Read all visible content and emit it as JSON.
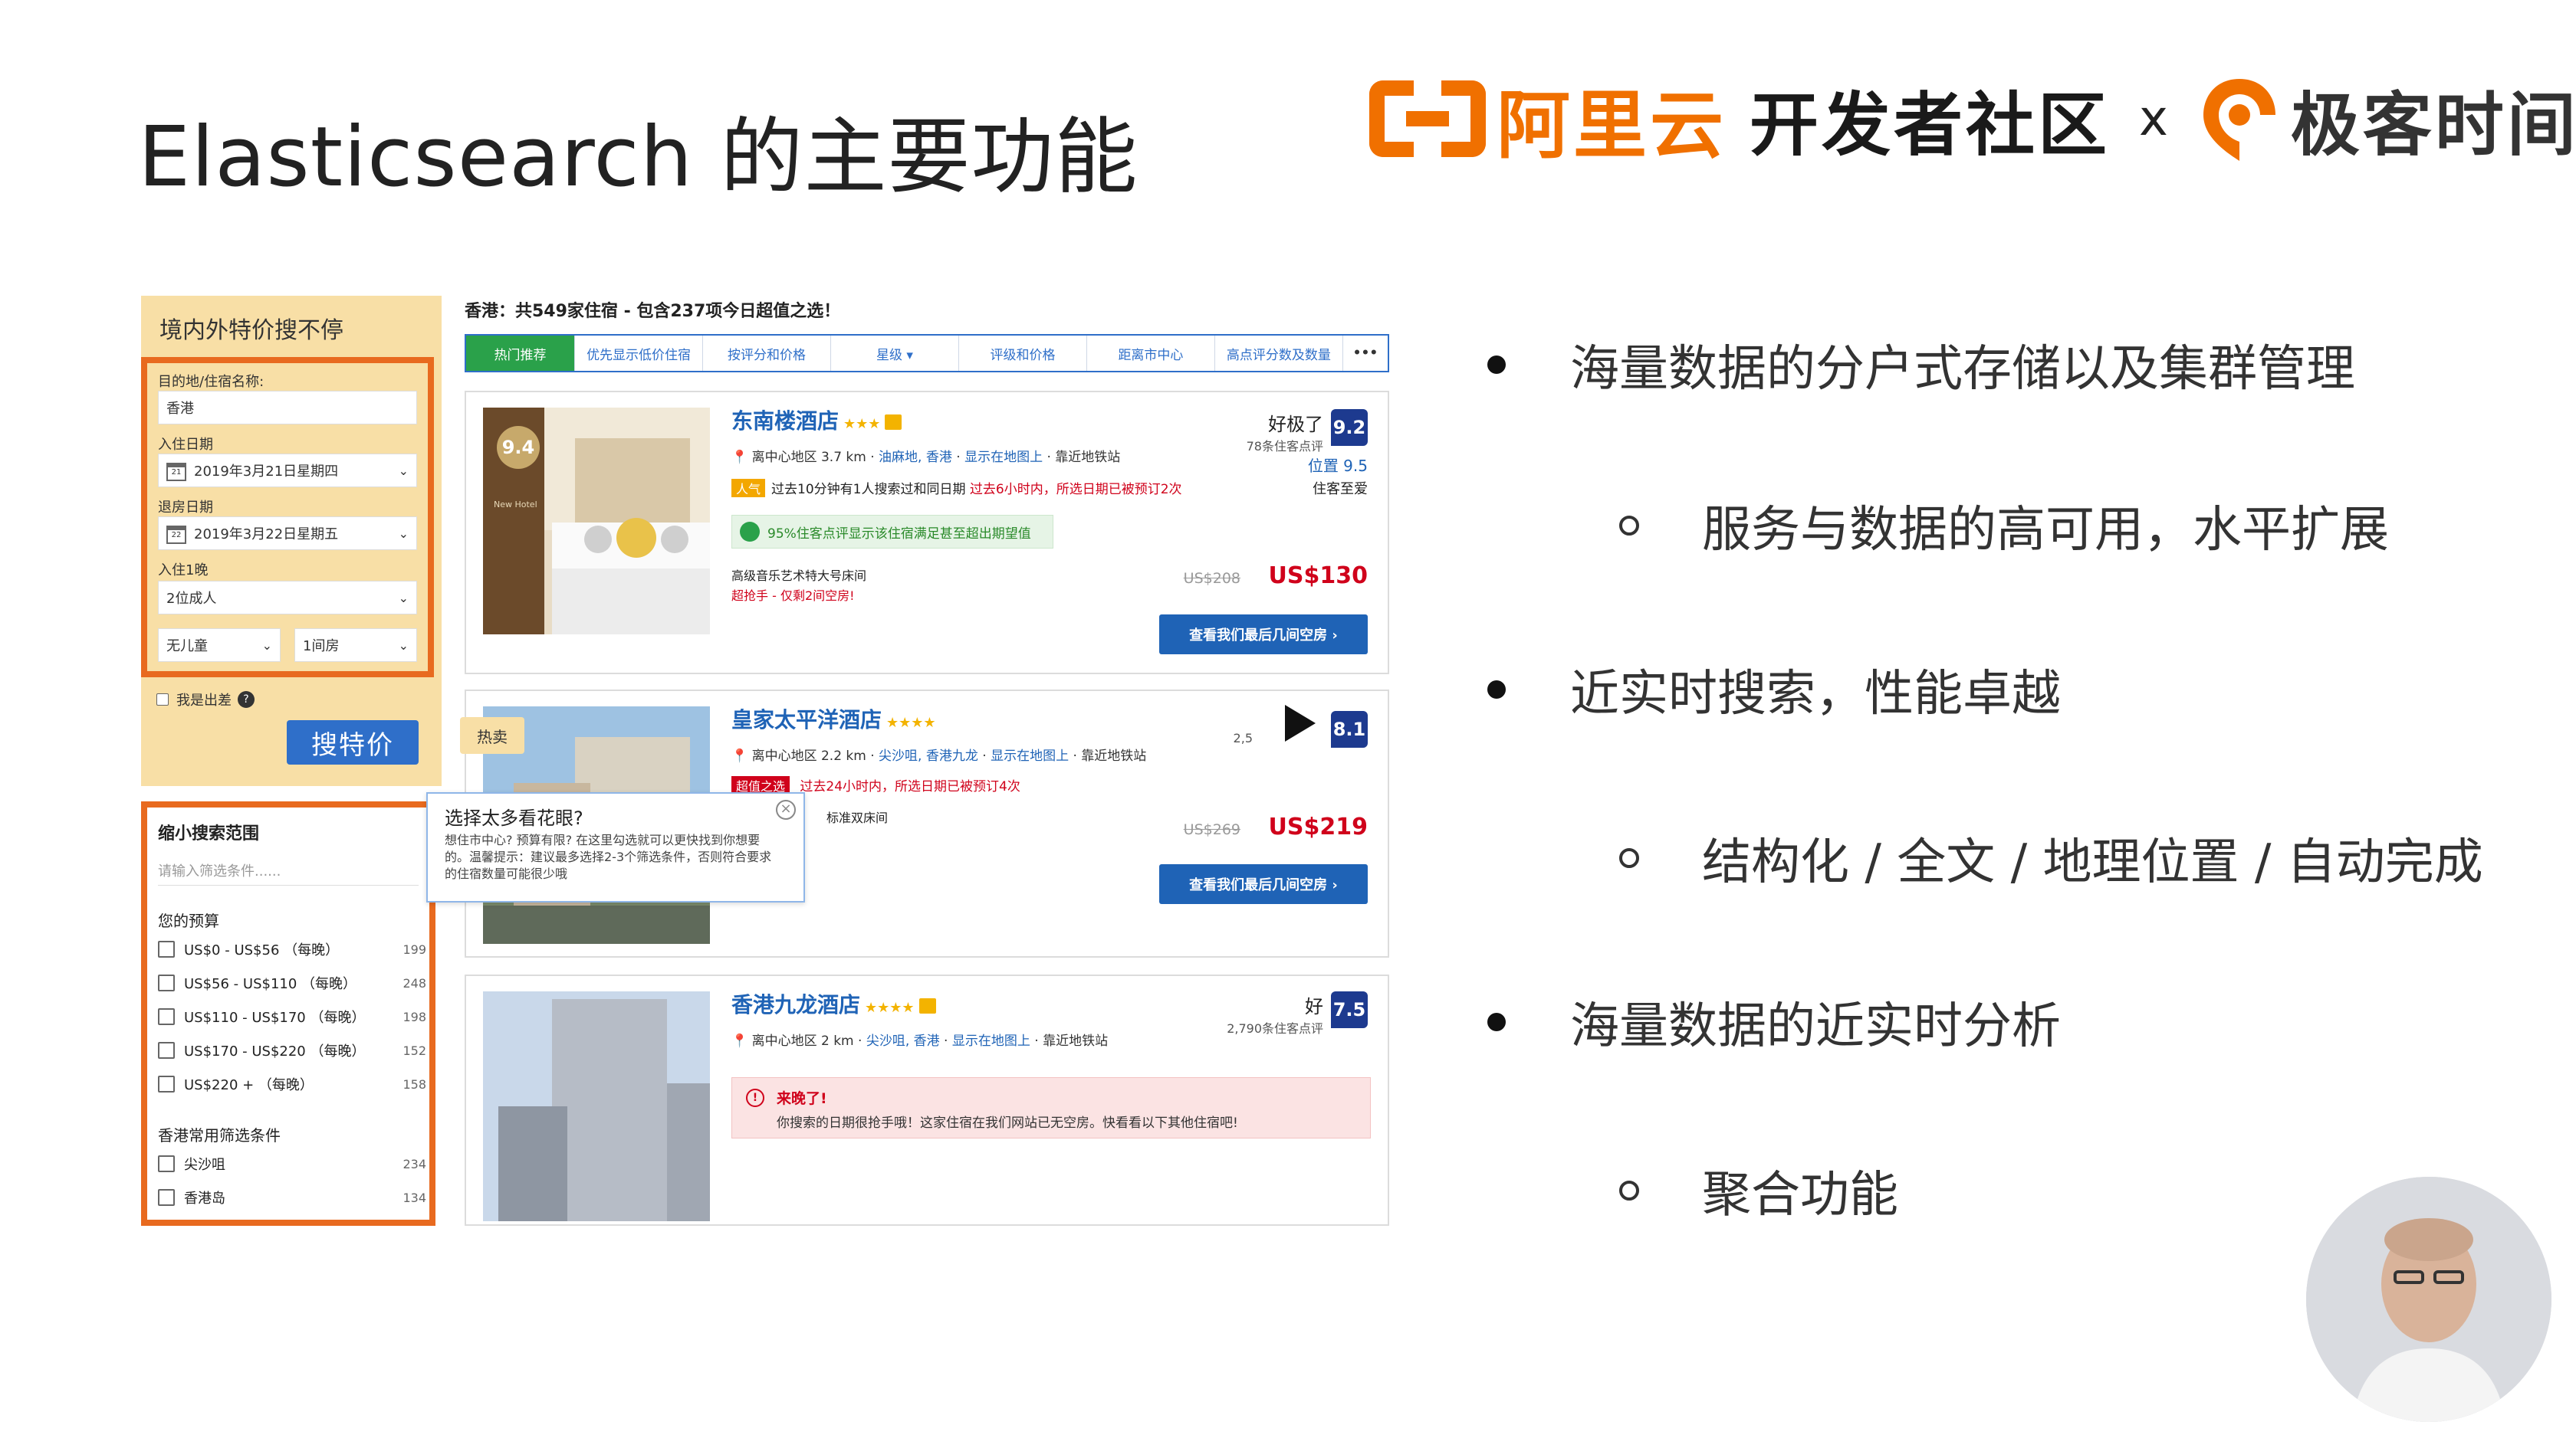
{
  "slide": {
    "title": "Elasticsearch 的主要功能",
    "brand": {
      "aliyun": "阿里云",
      "dev": "开发者社区",
      "x": "x",
      "geek": "极客时间",
      "accent_color": "#f07000"
    },
    "bullets": [
      {
        "text": "海量数据的分户式存储以及集群管理",
        "sub": "服务与数据的高可用，水平扩展"
      },
      {
        "text": "近实时搜索，性能卓越",
        "sub": "结构化 / 全文 / 地理位置 / 自动完成"
      },
      {
        "text": "海量数据的近实时分析",
        "sub": "聚合功能"
      }
    ]
  },
  "search_panel": {
    "title": "境内外特价搜不停",
    "dest_label": "目的地/住宿名称:",
    "dest_value": "香港",
    "checkin_label": "入住日期",
    "checkin_value": "2019年3月21日星期四",
    "checkin_day": "21",
    "checkout_label": "退房日期",
    "checkout_value": "2019年3月22日星期五",
    "checkout_day": "22",
    "nights_label": "入住1晚",
    "adults_value": "2位成人",
    "children_value": "无儿童",
    "rooms_value": "1间房",
    "business_label": "我是出差",
    "search_button": "搜特价"
  },
  "narrow_filter": {
    "title": "缩小搜索范围",
    "input_placeholder": "请输入筛选条件......",
    "budget_title": "您的预算",
    "budget": [
      {
        "label": "US$0 - US$56 （每晚）",
        "count": "199"
      },
      {
        "label": "US$56 - US$110 （每晚）",
        "count": "248"
      },
      {
        "label": "US$110 - US$170 （每晚）",
        "count": "198"
      },
      {
        "label": "US$170 - US$220 （每晚）",
        "count": "152"
      },
      {
        "label": "US$220 + （每晚）",
        "count": "158"
      }
    ],
    "common_title": "香港常用筛选条件",
    "common": [
      {
        "label": "尖沙咀",
        "count": "234"
      },
      {
        "label": "香港岛",
        "count": "134"
      }
    ]
  },
  "tooltip": {
    "title": "选择太多看花眼?",
    "body": "想住市中心? 预算有限? 在这里勾选就可以更快找到你想要的。温馨提示：建议最多选择2-3个筛选条件，否则符合要求的住宿数量可能很少哦",
    "close": "×"
  },
  "hot_tag": "热卖",
  "results": {
    "header": "香港：共549家住宿 - 包含237项今日超值之选！",
    "tabs": [
      "热门推荐",
      "优先显示低价住宿",
      "按评分和价格",
      "星级 ▾",
      "评级和价格",
      "距离市中心",
      "高点评分数及数量",
      "•••"
    ],
    "hotels": [
      {
        "name": "东南楼酒店",
        "stars": "★★★",
        "location": "离中心地区 3.7 km",
        "area": "油麻地, 香港",
        "map_link": "显示在地图上",
        "near": "靠近地铁站",
        "popular_tag": "人气",
        "popular_text": "过去10分钟有1人搜索过和同日期",
        "booked_text": "过去6小时内，所选日期已被预订2次",
        "green_note": "95%住客点评显示该住宿满足甚至超出期望值",
        "room": "高级音乐艺术特大号床间",
        "deal": "超抢手 - 仅剩2间空房!",
        "rating_word": "好极了",
        "reviews": "78条住客点评",
        "score": "9.2",
        "location_score": "位置 9.5",
        "extra": "住客至爱",
        "old_price": "US$208",
        "price": "US$130",
        "button": "查看我们最后几间空房 ›",
        "photo_badge": "9.4",
        "photo_caption": "New Hotel"
      },
      {
        "name": "皇家太平洋酒店",
        "stars": "★★★★",
        "location": "离中心地区 2.2 km",
        "area": "尖沙咀, 香港九龙",
        "map_link": "显示在地图上",
        "near": "靠近地铁站",
        "popular_tag": "超值之选",
        "booked_text": "过去24小时内，所选日期已被预订4次",
        "room": "标准双床间",
        "reviews": "2,5",
        "score": "8.1",
        "old_price": "US$269",
        "price": "US$219",
        "button": "查看我们最后几间空房 ›"
      },
      {
        "name": "香港九龙酒店",
        "stars": "★★★★",
        "location": "离中心地区 2 km",
        "area": "尖沙咀, 香港",
        "map_link": "显示在地图上",
        "near": "靠近地铁站",
        "rating_word": "好",
        "reviews": "2,790条住客点评",
        "score": "7.5",
        "soldout_title": "来晚了!",
        "soldout_text": "你搜索的日期很抢手哦！这家住宿在我们网站已无空房。快看看以下其他住宿吧!",
        "soldout_icon": "!"
      }
    ]
  }
}
